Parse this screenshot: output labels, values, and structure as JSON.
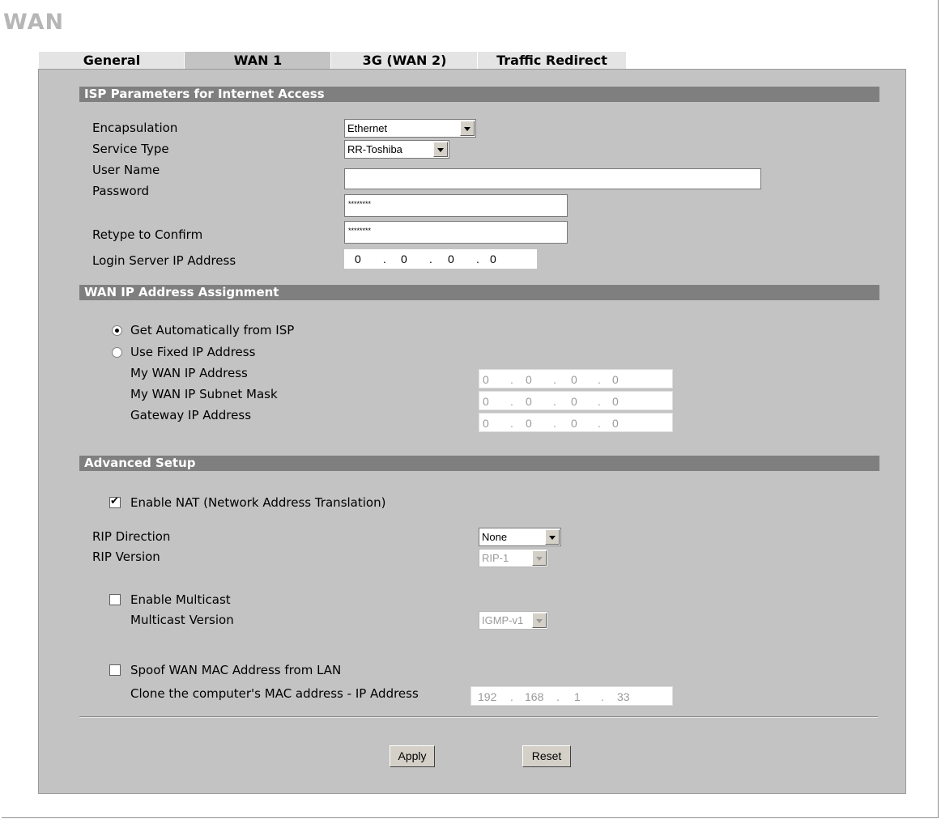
{
  "title": "WAN",
  "tabs": [
    {
      "label": "General"
    },
    {
      "label": "WAN 1"
    },
    {
      "label": "3G (WAN 2)"
    },
    {
      "label": "Traffic Redirect"
    }
  ],
  "isp": {
    "section_title": "ISP Parameters for Internet Access",
    "encapsulation_label": "Encapsulation",
    "encapsulation_value": "Ethernet",
    "service_type_label": "Service Type",
    "service_type_value": "RR-Toshiba",
    "user_name_label": "User Name",
    "user_name_value": "",
    "password_label": "Password",
    "password_value": "********",
    "retype_label": "Retype to Confirm",
    "retype_value": "********",
    "login_server_label": "Login Server IP Address",
    "login_server_ip": [
      "0",
      "0",
      "0",
      "0"
    ]
  },
  "wan_ip": {
    "section_title": "WAN IP Address Assignment",
    "auto_label": "Get Automatically from ISP",
    "fixed_label": "Use Fixed IP Address",
    "my_wan_ip_label": "My WAN IP Address",
    "my_wan_ip": [
      "0",
      "0",
      "0",
      "0"
    ],
    "subnet_label": "My WAN IP Subnet Mask",
    "subnet": [
      "0",
      "0",
      "0",
      "0"
    ],
    "gateway_label": "Gateway IP Address",
    "gateway": [
      "0",
      "0",
      "0",
      "0"
    ]
  },
  "advanced": {
    "section_title": "Advanced Setup",
    "nat_label": "Enable NAT (Network Address Translation)",
    "rip_direction_label": "RIP Direction",
    "rip_direction_value": "None",
    "rip_version_label": "RIP Version",
    "rip_version_value": "RIP-1",
    "multicast_label": "Enable Multicast",
    "multicast_version_label": "Multicast Version",
    "multicast_version_value": "IGMP-v1",
    "spoof_label": "Spoof WAN MAC Address from LAN",
    "clone_label": "Clone the computer's MAC address - IP Address",
    "clone_ip": [
      "192",
      "168",
      "1",
      "33"
    ]
  },
  "buttons": {
    "apply": "Apply",
    "reset": "Reset"
  }
}
